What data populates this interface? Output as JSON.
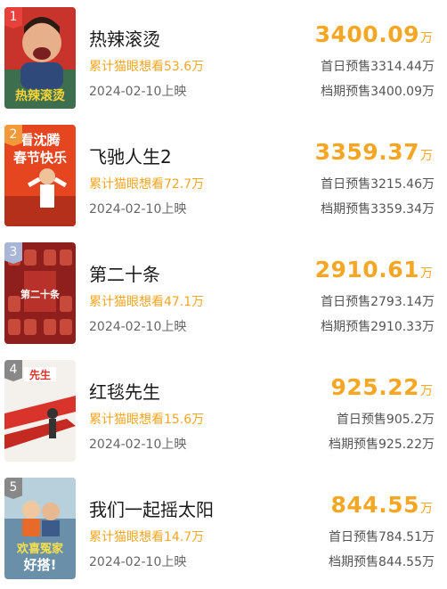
{
  "movies": [
    {
      "rank": "1",
      "title": "热辣滚烫",
      "box_value": "3400.09",
      "box_unit": "万",
      "wish": "累计猫眼想看53.6万",
      "release": "2024-02-10上映",
      "first_day_presale": "首日预售3314.44万",
      "period_presale": "档期预售3400.09万",
      "poster_text": "热辣滚烫",
      "badge_color": "#e8413c"
    },
    {
      "rank": "2",
      "title": "飞驰人生2",
      "box_value": "3359.37",
      "box_unit": "万",
      "wish": "累计猫眼想看72.7万",
      "release": "2024-02-10上映",
      "first_day_presale": "首日预售3215.46万",
      "period_presale": "档期预售3359.34万",
      "poster_text_line1": "看沈腾",
      "poster_text_line2": "春节快乐",
      "badge_color": "#f29a3a"
    },
    {
      "rank": "3",
      "title": "第二十条",
      "box_value": "2910.61",
      "box_unit": "万",
      "wish": "累计猫眼想看47.1万",
      "release": "2024-02-10上映",
      "first_day_presale": "首日预售2793.14万",
      "period_presale": "档期预售2910.33万",
      "poster_text": "第二十条",
      "badge_color": "#a9b6d8"
    },
    {
      "rank": "4",
      "title": "红毯先生",
      "box_value": "925.22",
      "box_unit": "万",
      "wish": "累计猫眼想看15.6万",
      "release": "2024-02-10上映",
      "first_day_presale": "首日预售905.2万",
      "period_presale": "档期预售925.22万",
      "poster_text": "先生",
      "badge_color": "#888888"
    },
    {
      "rank": "5",
      "title": "我们一起摇太阳",
      "box_value": "844.55",
      "box_unit": "万",
      "wish": "累计猫眼想看14.7万",
      "release": "2024-02-10上映",
      "first_day_presale": "首日预售784.51万",
      "period_presale": "档期预售844.55万",
      "poster_text_line1": "欢喜冤家",
      "poster_text_line2": "好搭!",
      "badge_color": "#888888"
    }
  ],
  "colors": {
    "accent": "#f5a623",
    "wish": "#f5a623",
    "secondary_text": "#666666"
  }
}
